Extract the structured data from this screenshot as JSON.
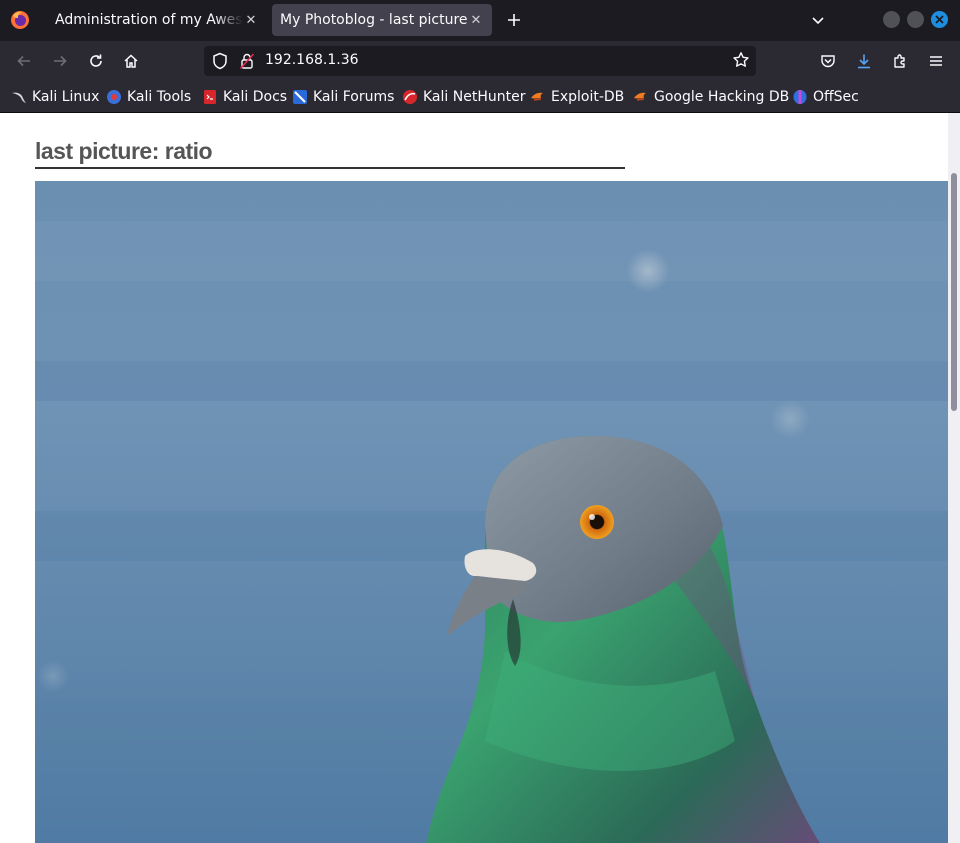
{
  "browser": {
    "tabs": [
      {
        "title": "Administration of my Awesome Photoblog",
        "active": false
      },
      {
        "title": "My Photoblog - last picture",
        "active": true
      }
    ],
    "address": "192.168.1.36",
    "accent": "#1e8ee0"
  },
  "toolbar": {
    "icons": [
      "back-icon",
      "forward-icon",
      "reload-icon",
      "home-icon",
      "pocket-icon",
      "downloads-icon",
      "extensions-icon",
      "menu-icon"
    ]
  },
  "bookmarks": [
    {
      "label": "Kali Linux",
      "icon": "kali-dragon-icon"
    },
    {
      "label": "Kali Tools",
      "icon": "kali-tools-icon"
    },
    {
      "label": "Kali Docs",
      "icon": "kali-docs-icon"
    },
    {
      "label": "Kali Forums",
      "icon": "kali-forums-icon"
    },
    {
      "label": "Kali NetHunter",
      "icon": "kali-nethunter-icon"
    },
    {
      "label": "Exploit-DB",
      "icon": "exploit-db-icon"
    },
    {
      "label": "Google Hacking DB",
      "icon": "ghdb-icon"
    },
    {
      "label": "OffSec",
      "icon": "offsec-icon"
    }
  ],
  "page": {
    "heading": "last picture: ratio",
    "image_subject": "pigeon"
  }
}
